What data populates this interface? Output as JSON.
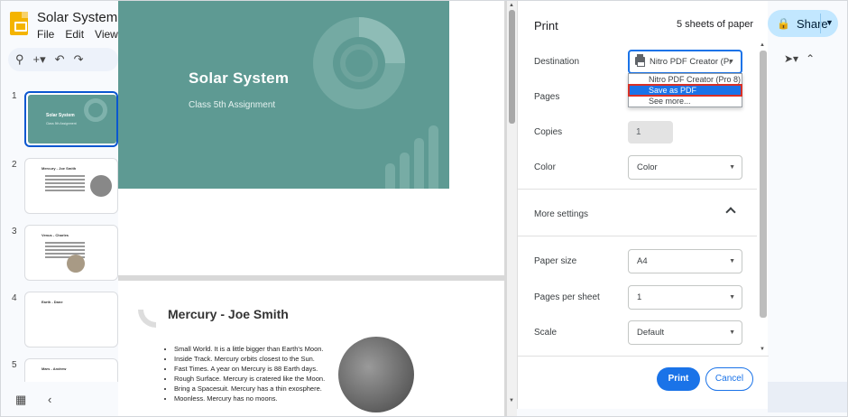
{
  "app": {
    "title": "Solar System",
    "title_suffix": "-",
    "menu": [
      "File",
      "Edit",
      "View"
    ],
    "share_label": "Share"
  },
  "filmstrip": {
    "slides": [
      {
        "number": "1",
        "title": "Solar System",
        "subtitle": "Class 5th Assignment"
      },
      {
        "number": "2",
        "title": "Mercury - Joe Smith"
      },
      {
        "number": "3",
        "title": "Venus - Charles"
      },
      {
        "number": "4",
        "title": "Earth - Dane"
      },
      {
        "number": "5",
        "title": "Mars - Andrew"
      }
    ]
  },
  "preview": {
    "slide1": {
      "title": "Solar System",
      "subtitle": "Class 5th Assignment"
    },
    "slide2": {
      "title": "Mercury - Joe Smith",
      "bullets": [
        "Small World. It is a little bigger than Earth's Moon.",
        "Inside Track. Mercury orbits closest to the Sun.",
        "Fast Times. A year on Mercury is 88 Earth days.",
        "Rough Surface. Mercury is cratered like the Moon.",
        "Bring a Spacesuit. Mercury has a thin exosphere.",
        "Moonless. Mercury has no moons."
      ]
    }
  },
  "print": {
    "title": "Print",
    "sheets": "5 sheets of paper",
    "destination_label": "Destination",
    "destination_value": "Nitro PDF Creator (Pr",
    "destination_options": [
      "Nitro PDF Creator (Pro 8)",
      "Save as PDF",
      "See more..."
    ],
    "selected_option": "Save as PDF",
    "pages_label": "Pages",
    "copies_label": "Copies",
    "copies_value": "1",
    "color_label": "Color",
    "color_value": "Color",
    "more_settings_label": "More settings",
    "paper_size_label": "Paper size",
    "paper_size_value": "A4",
    "pages_per_sheet_label": "Pages per sheet",
    "pages_per_sheet_value": "1",
    "scale_label": "Scale",
    "scale_value": "Default",
    "print_button": "Print",
    "cancel_button": "Cancel"
  },
  "colors": {
    "slide_teal": "#5e9a93",
    "accent_blue": "#1a73e8",
    "highlight_red": "#d93025",
    "share_bg": "#c2e7ff"
  }
}
